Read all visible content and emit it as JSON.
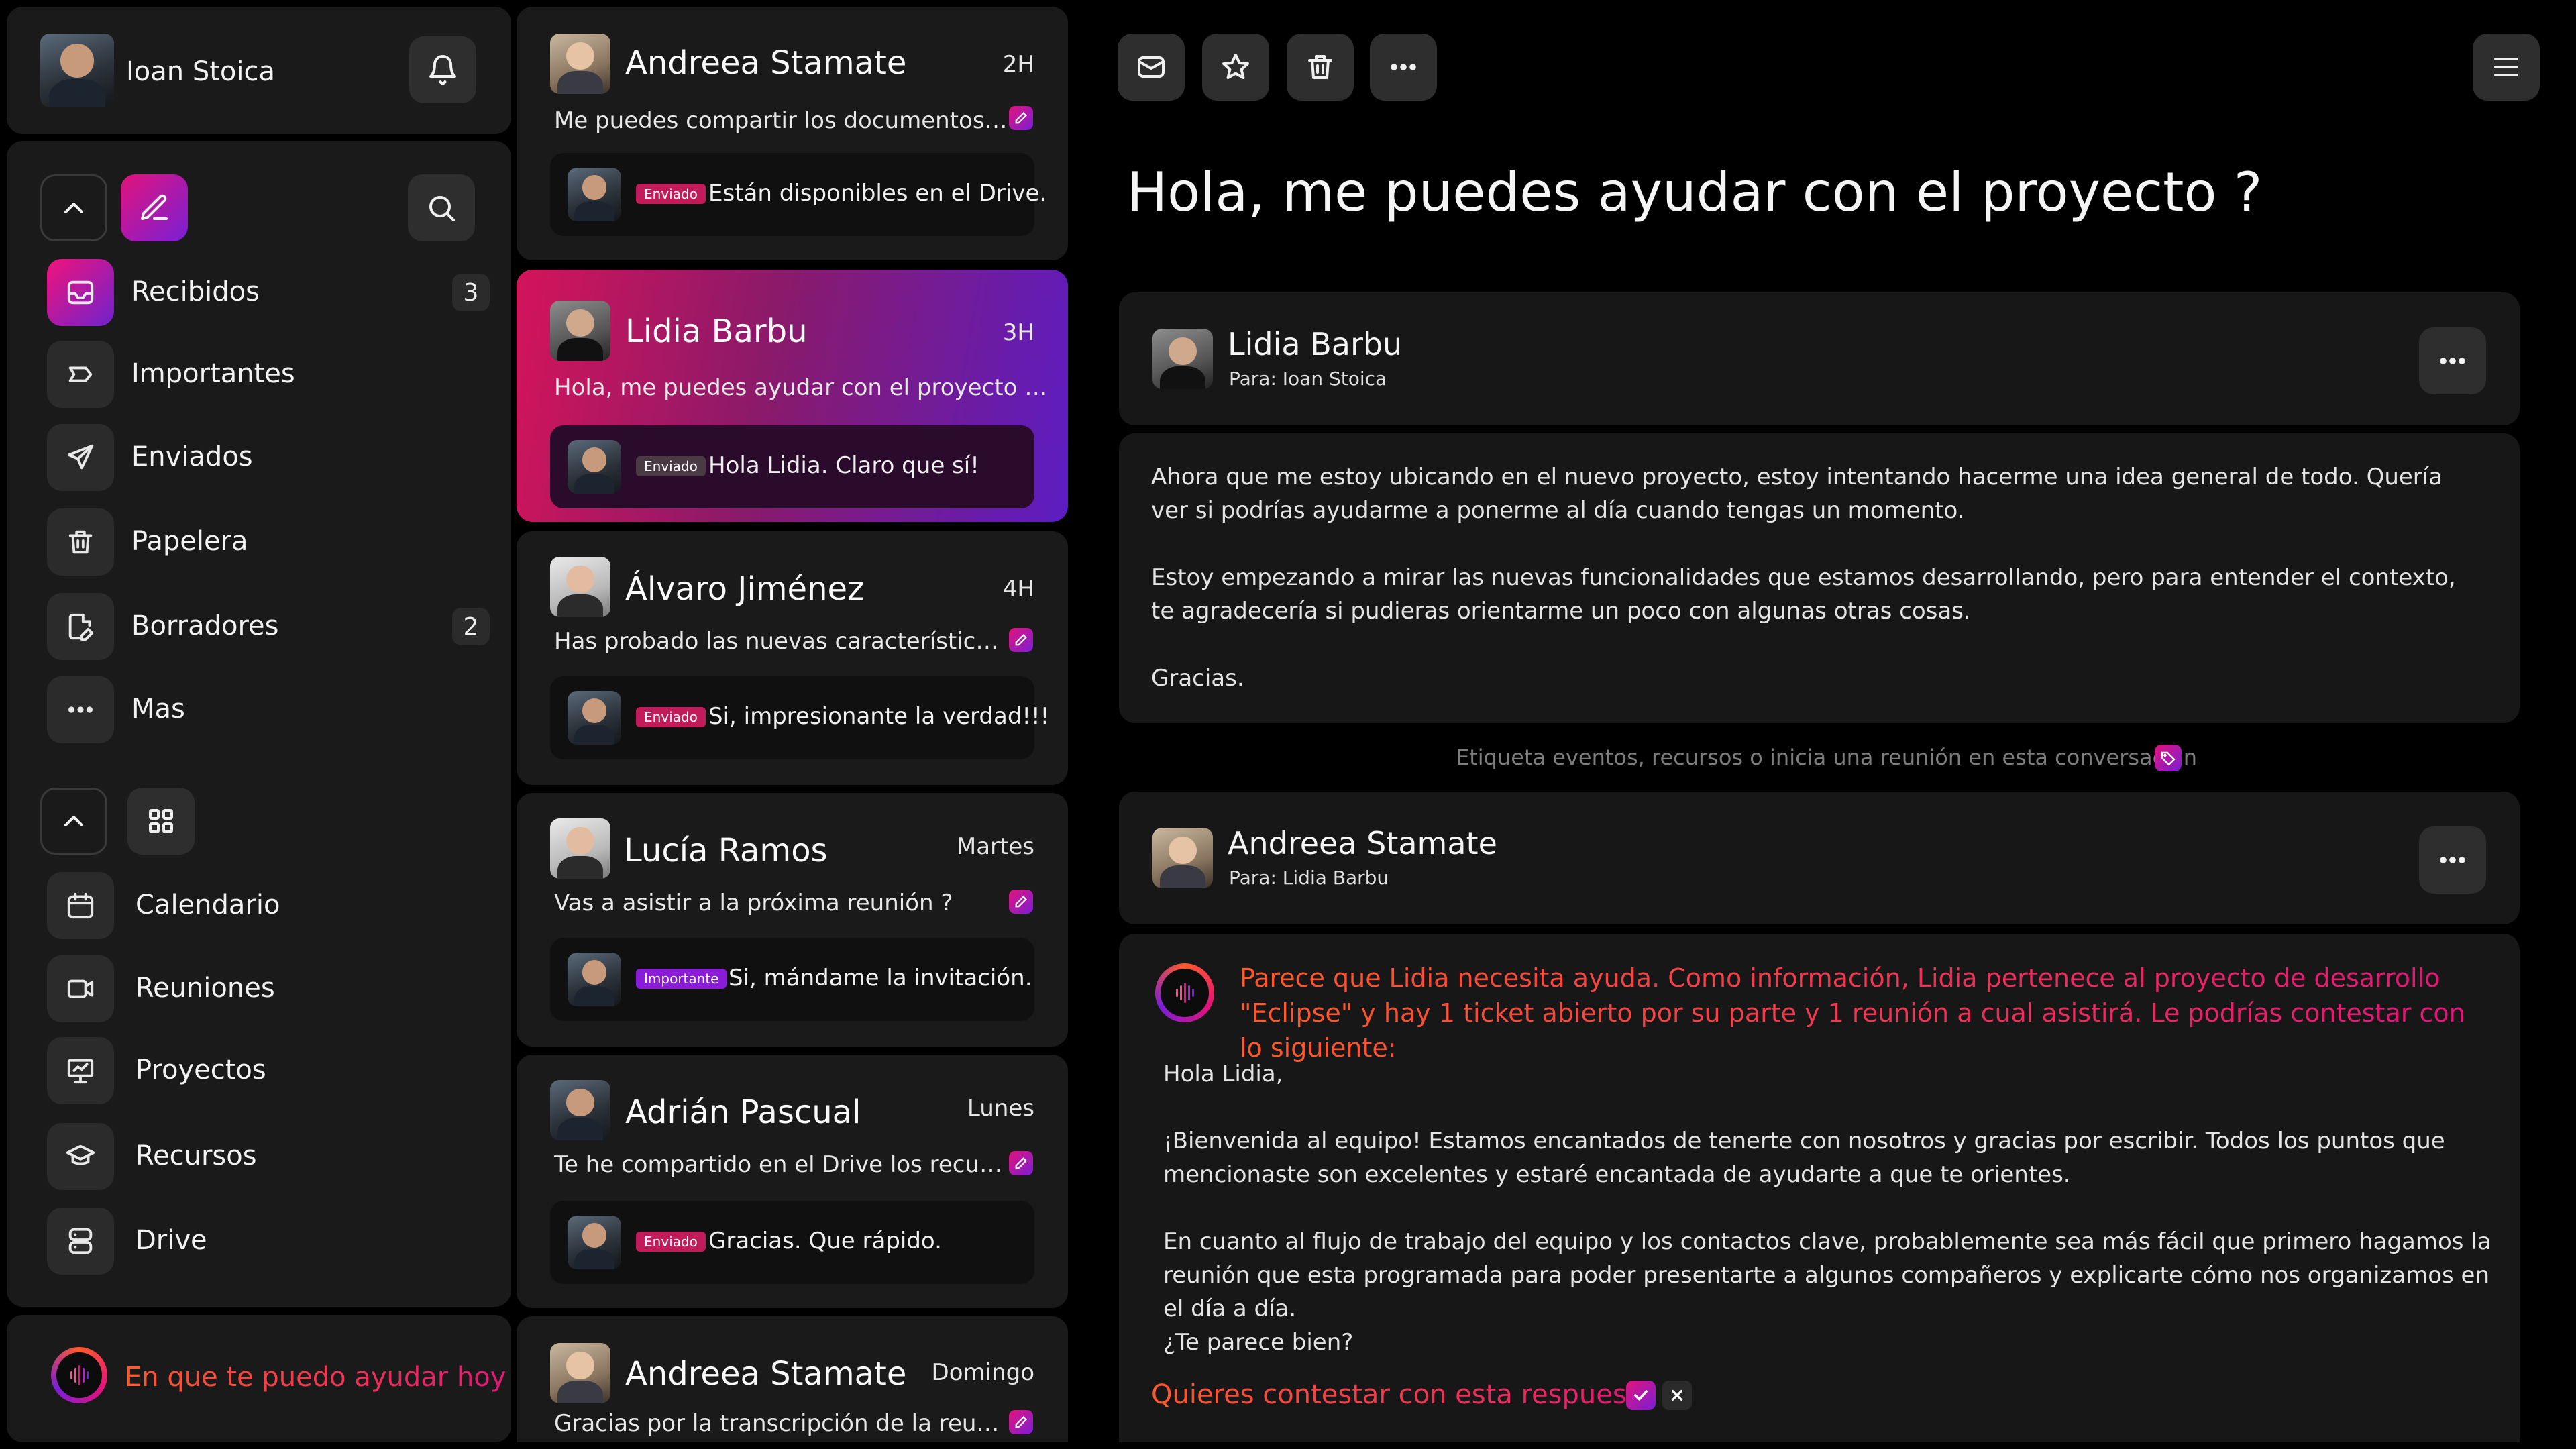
{
  "user": {
    "name": "Ioan Stoica"
  },
  "sidebar": {
    "mail_items": [
      {
        "label": "Recibidos",
        "badge": "3"
      },
      {
        "label": "Importantes",
        "badge": ""
      },
      {
        "label": "Enviados",
        "badge": ""
      },
      {
        "label": "Papelera",
        "badge": ""
      },
      {
        "label": "Borradores",
        "badge": "2"
      },
      {
        "label": "Mas",
        "badge": ""
      }
    ],
    "app_items": [
      {
        "label": "Calendario"
      },
      {
        "label": "Reuniones"
      },
      {
        "label": "Proyectos"
      },
      {
        "label": "Recursos"
      },
      {
        "label": "Drive"
      }
    ],
    "assistant_prompt": "En que te puedo ayudar hoy ?"
  },
  "mail_list": [
    {
      "sender": "Andreea Stamate",
      "time": "2H",
      "preview": "Me puedes compartir los documentos que...",
      "reply_tag": "Enviado",
      "reply_text": "Están disponibles en el Drive."
    },
    {
      "sender": "Lidia Barbu",
      "time": "3H",
      "preview": "Hola, me puedes ayudar con el proyecto que...",
      "reply_tag": "Enviado",
      "reply_text": "Hola Lidia. Claro que sí!"
    },
    {
      "sender": "Álvaro Jiménez",
      "time": "4H",
      "preview": "Has probado las nuevas características ?",
      "reply_tag": "Enviado",
      "reply_text": "Si, impresionante la verdad!!!"
    },
    {
      "sender": "Lucía Ramos",
      "time": "Martes",
      "preview": "Vas a asistir a la próxima reunión ?",
      "reply_tag": "Importante",
      "reply_text": "Si, mándame la invitación."
    },
    {
      "sender": "Adrián Pascual",
      "time": "Lunes",
      "preview": "Te he compartido en el Drive los recursos...",
      "reply_tag": "Enviado",
      "reply_text": "Gracias. Que rápido."
    },
    {
      "sender": "Andreea Stamate",
      "time": "Domingo",
      "preview": "Gracias por la transcripción de la reunión..."
    }
  ],
  "thread": {
    "subject": "Hola, me puedes ayudar con el proyecto ?",
    "message1": {
      "sender": "Lidia Barbu",
      "to": "Para: Ioan Stoica",
      "paragraphs": [
        "Ahora que me estoy ubicando en el nuevo proyecto, estoy intentando hacerme una idea general de todo. Quería ver si podrías ayudarme a ponerme al día cuando tengas un momento.",
        "Estoy empezando a mirar las nuevas funcionalidades que estamos desarrollando, pero para entender el contexto, te agradecería si pudieras orientarme un poco con algunas otras cosas.",
        "Gracias."
      ]
    },
    "tag_hint": "Etiqueta eventos, recursos o inicia una reunión en esta conversación",
    "message2": {
      "sender": "Andreea Stamate",
      "to": "Para: Lidia Barbu",
      "ai_note": "Parece que Lidia necesita ayuda. Como información, Lidia pertenece al proyecto de desarrollo  \"Eclipse\" y hay 1 ticket abierto por su parte y 1 reunión a cual asistirá. Le podrías contestar con lo siguiente:",
      "paragraphs": [
        "Hola Lidia,",
        "¡Bienvenida al equipo! Estamos encantados de tenerte con nosotros y gracias por escribir. Todos los puntos que mencionaste son excelentes y estaré encantada de ayudarte a que te orientes.",
        "En cuanto al flujo de trabajo del equipo y los contactos clave, probablemente sea más fácil que primero hagamos la reunión que esta programada para poder presentarte a algunos compañeros y explicarte cómo nos organizamos en el día a día.",
        "¿Te parece bien?"
      ],
      "confirm_question": "Quieres contestar con esta respuesta ?"
    }
  },
  "colors": {
    "accent_pink": "#e2137a",
    "accent_purple": "#7a1fd6",
    "accent_orange": "#ff5a2a"
  }
}
